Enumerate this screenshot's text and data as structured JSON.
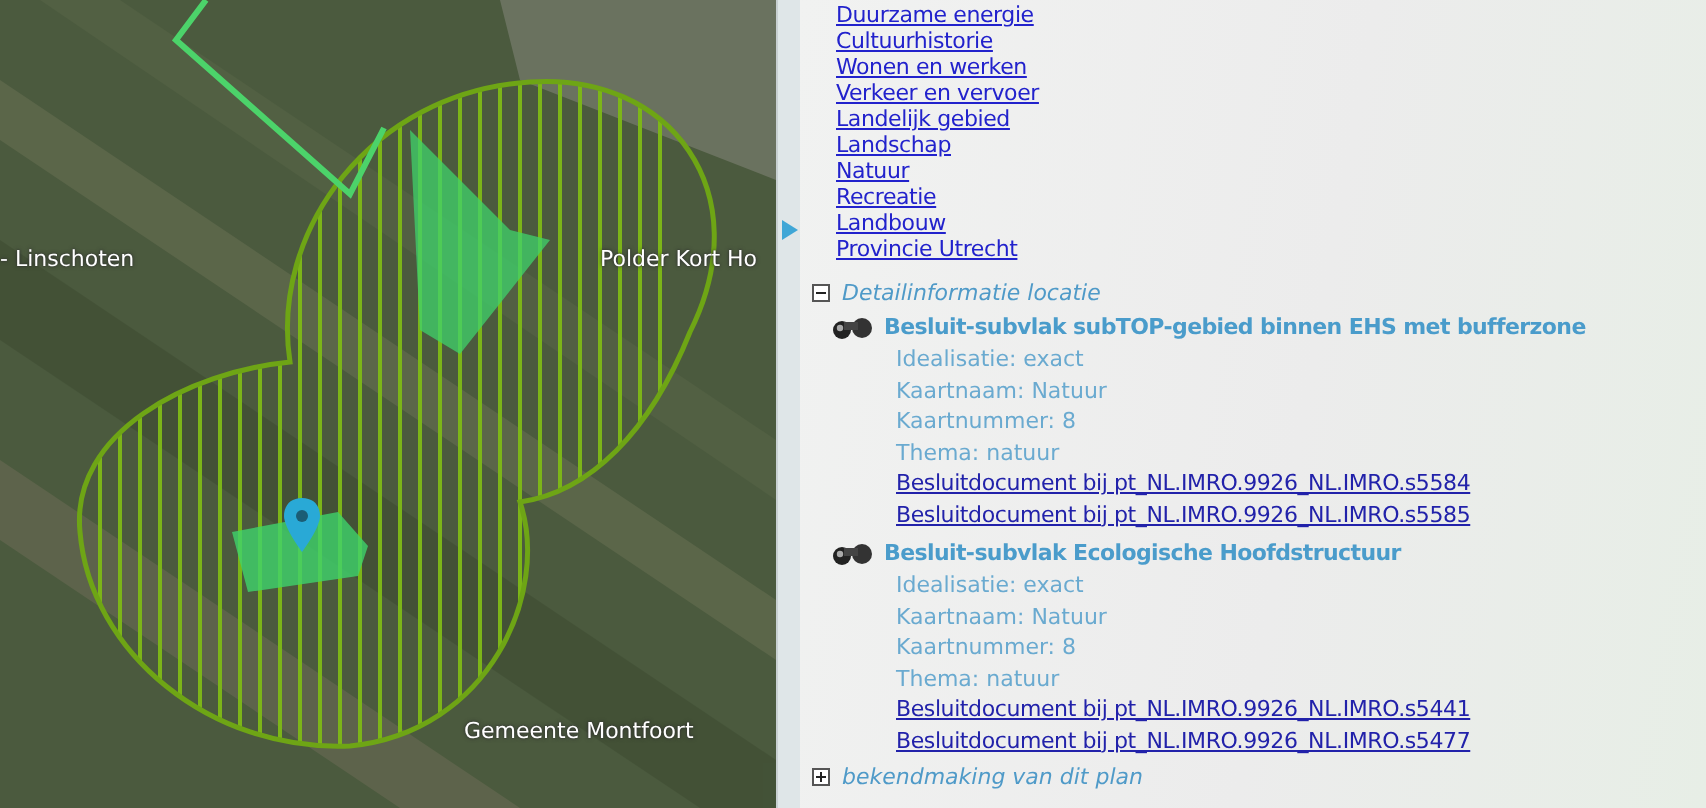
{
  "map": {
    "labels": [
      {
        "text": "- Linschoten"
      },
      {
        "text": "Polder Kort Ho"
      },
      {
        "text": "Gemeente Montfoort"
      }
    ]
  },
  "panel": {
    "theme_links": [
      "Duurzame energie",
      "Cultuurhistorie",
      "Wonen en werken",
      "Verkeer en vervoer",
      "Landelijk gebied",
      "Landschap",
      "Natuur",
      "Recreatie",
      "Landbouw",
      "Provincie Utrecht"
    ],
    "section": {
      "title": "Detailinformatie locatie",
      "expanded": true,
      "items": [
        {
          "title": "Besluit-subvlak subTOP-gebied binnen EHS met bufferzone",
          "attributes": [
            "Idealisatie: exact",
            "Kaartnaam: Natuur",
            "Kaartnummer: 8",
            "Thema: natuur"
          ],
          "links": [
            "Besluitdocument bij pt_NL.IMRO.9926_NL.IMRO.s5584",
            "Besluitdocument bij pt_NL.IMRO.9926_NL.IMRO.s5585"
          ]
        },
        {
          "title": "Besluit-subvlak Ecologische Hoofdstructuur",
          "attributes": [
            "Idealisatie: exact",
            "Kaartnaam: Natuur",
            "Kaartnummer: 8",
            "Thema: natuur"
          ],
          "links": [
            "Besluitdocument bij pt_NL.IMRO.9926_NL.IMRO.s5441",
            "Besluitdocument bij pt_NL.IMRO.9926_NL.IMRO.s5477"
          ]
        }
      ]
    },
    "next_section": {
      "title": "bekendmaking van dit plan",
      "expanded": false
    }
  }
}
